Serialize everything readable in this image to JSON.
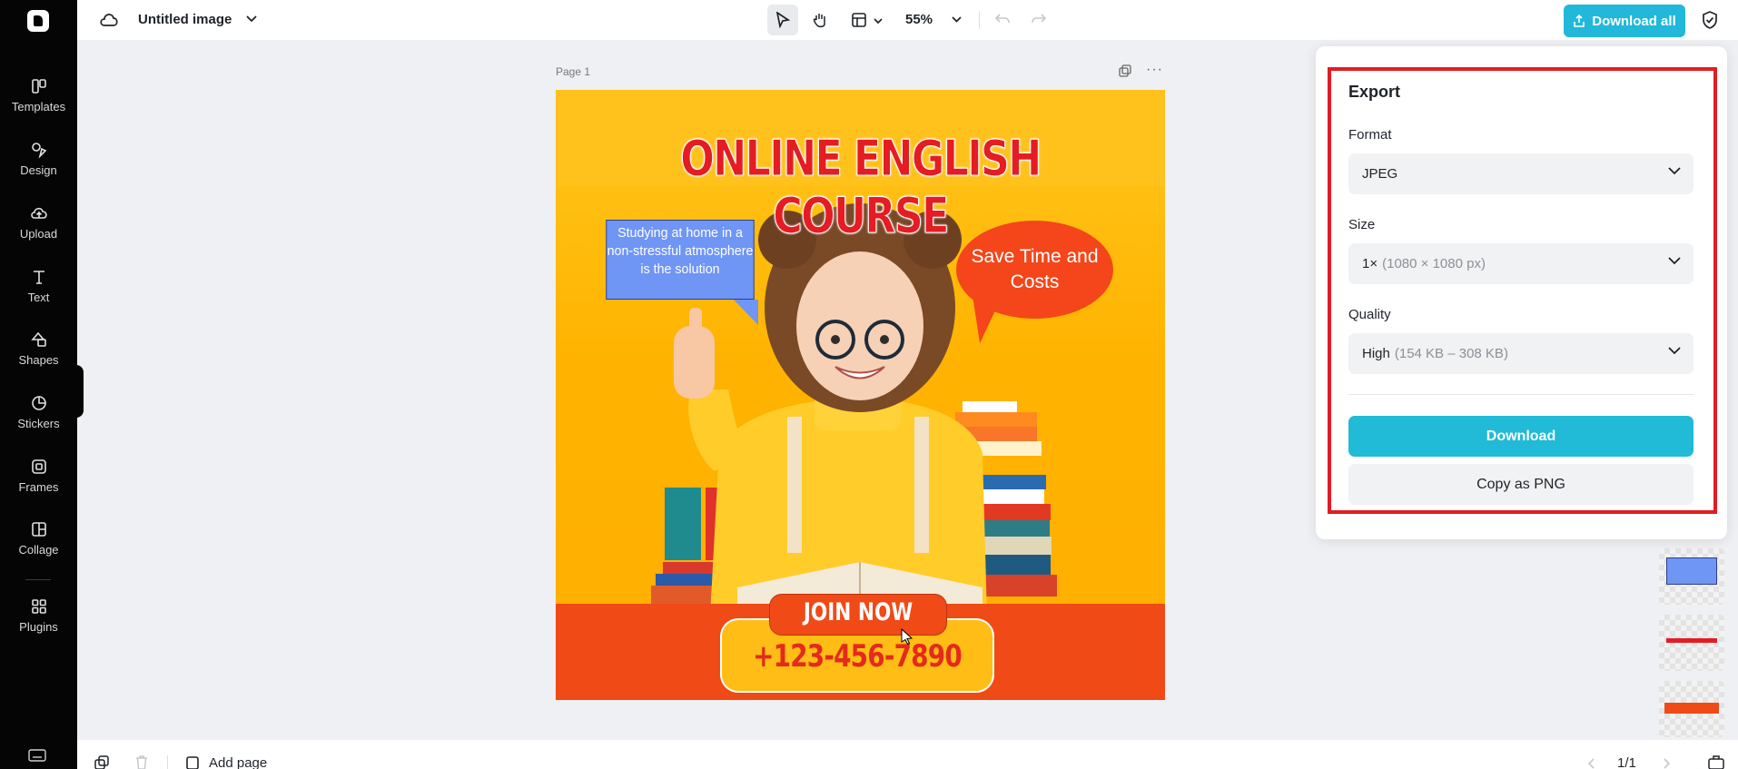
{
  "sidebar": {
    "items": [
      {
        "label": "Templates",
        "icon": "templates-icon"
      },
      {
        "label": "Design",
        "icon": "design-icon"
      },
      {
        "label": "Upload",
        "icon": "upload-icon"
      },
      {
        "label": "Text",
        "icon": "text-icon"
      },
      {
        "label": "Shapes",
        "icon": "shapes-icon"
      },
      {
        "label": "Stickers",
        "icon": "stickers-icon"
      },
      {
        "label": "Frames",
        "icon": "frames-icon"
      },
      {
        "label": "Collage",
        "icon": "collage-icon"
      },
      {
        "label": "Plugins",
        "icon": "plugins-icon"
      }
    ]
  },
  "topbar": {
    "doc_title": "Untitled image",
    "zoom": "55%",
    "download_all_label": "Download all"
  },
  "canvas": {
    "page_label": "Page 1",
    "poster": {
      "headline": "ONLINE ENGLISH COURSE",
      "bubble_left": "Studying at home in a non-stressful atmosphere is the solution",
      "bubble_right": "Save Time and Costs",
      "join_label": "JOIN NOW",
      "phone": "+123-456-7890"
    }
  },
  "export": {
    "title": "Export",
    "format_label": "Format",
    "format_value": "JPEG",
    "size_label": "Size",
    "size_value": "1×",
    "size_detail": "(1080 × 1080 px)",
    "quality_label": "Quality",
    "quality_value": "High",
    "quality_detail": "(154 KB – 308 KB)",
    "download_label": "Download",
    "copy_label": "Copy as PNG"
  },
  "bottom": {
    "add_page_label": "Add page",
    "page_counter": "1/1"
  },
  "colors": {
    "accent": "#21b8da",
    "highlight_border": "#e21c24",
    "poster_orange": "#f04a17",
    "poster_yellow": "#ffb300"
  }
}
